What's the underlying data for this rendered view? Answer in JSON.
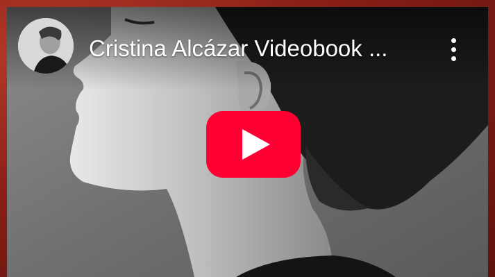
{
  "video": {
    "title": "Cristina Alcázar Videobook ...",
    "avatar_icon": "channel-avatar-icon",
    "menu_icon": "more-vertical-icon",
    "play_icon": "youtube-play-icon"
  },
  "colors": {
    "play_button": "#ff0033",
    "play_triangle": "#ffffff",
    "border": "#8a1f16"
  }
}
